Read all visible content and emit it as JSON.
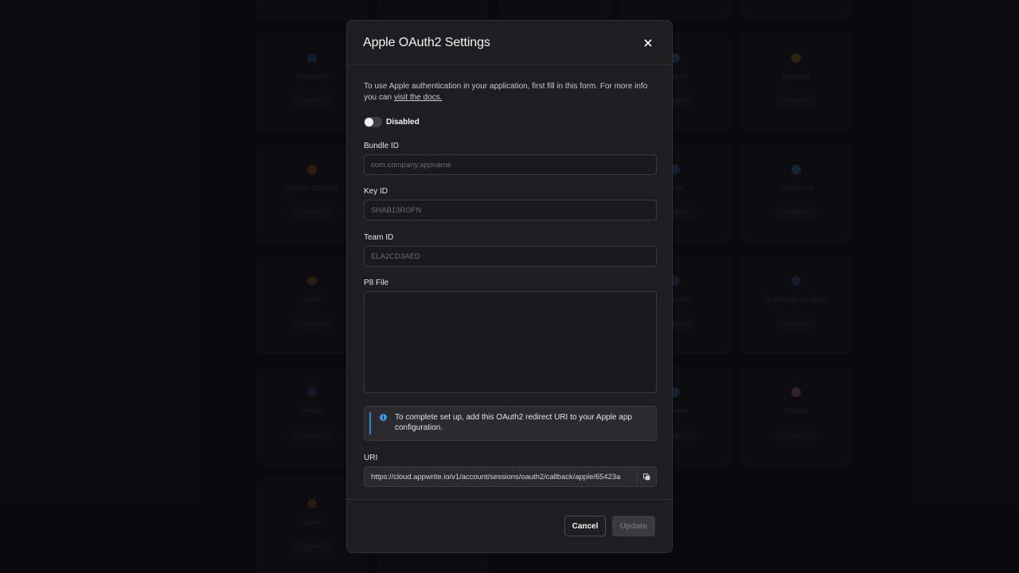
{
  "background_cards": [
    {
      "name": "",
      "badge": "Disabled",
      "icon_color": "#3a3a44"
    },
    {
      "name": "",
      "badge": "Disabled",
      "icon_color": "#3a3a44"
    },
    {
      "name": "",
      "badge": "Disabled",
      "icon_color": "#3a3a44"
    },
    {
      "name": "",
      "badge": "Disabled",
      "icon_color": "#3a3a44"
    },
    {
      "name": "",
      "badge": "Disabled",
      "icon_color": "#3a3a44"
    },
    {
      "name": "Facebook",
      "badge": "Disabled",
      "icon_color": "#2d5aa8"
    },
    {
      "name": "",
      "badge": "",
      "icon_color": "#3a3a44"
    },
    {
      "name": "",
      "badge": "",
      "icon_color": "#3a3a44"
    },
    {
      "name": "Linkedin",
      "badge": "Disabled",
      "icon_color": "#2b6ea8"
    },
    {
      "name": "Microsoft",
      "badge": "Disabled",
      "icon_color": "#9a7a2a"
    },
    {
      "name": "OpenID Connect",
      "badge": "Disabled",
      "icon_color": "#a8561e"
    },
    {
      "name": "",
      "badge": "",
      "icon_color": "#3a3a44"
    },
    {
      "name": "",
      "badge": "",
      "icon_color": "#3a3a44"
    },
    {
      "name": "Podio",
      "badge": "Disabled",
      "icon_color": "#2b6ea8"
    },
    {
      "name": "Salesforce",
      "badge": "Disabled",
      "icon_color": "#2b7fb8"
    },
    {
      "name": "Slack",
      "badge": "Disabled",
      "icon_color": "#8a5a2a"
    },
    {
      "name": "",
      "badge": "",
      "icon_color": "#3a3a44"
    },
    {
      "name": "",
      "badge": "",
      "icon_color": "#3a3a44"
    },
    {
      "name": "Tradeshift",
      "badge": "Disabled",
      "icon_color": "#2b5a88"
    },
    {
      "name": "Tradeshift Sandbox",
      "badge": "Disabled",
      "icon_color": "#2b5a88"
    },
    {
      "name": "Twitch",
      "badge": "Disabled",
      "icon_color": "#4a3a7a"
    },
    {
      "name": "",
      "badge": "",
      "icon_color": "#3a3a44"
    },
    {
      "name": "",
      "badge": "",
      "icon_color": "#3a3a44"
    },
    {
      "name": "Yammer",
      "badge": "Disabled",
      "icon_color": "#2b6ea8"
    },
    {
      "name": "Yandex",
      "badge": "Disabled",
      "icon_color": "#a86a8a"
    },
    {
      "name": "Zoho",
      "badge": "Disabled",
      "icon_color": "#7a5a2a"
    },
    {
      "name": "",
      "badge": "Disabled",
      "icon_color": "#3a3a44"
    }
  ],
  "modal": {
    "title": "Apple OAuth2 Settings",
    "description": "To use Apple authentication in your application, first fill in this form. For more info you can ",
    "docs_link": "visit the docs.",
    "toggle": {
      "label": "Disabled",
      "enabled": false
    },
    "bundle_id": {
      "label": "Bundle ID",
      "placeholder": "com.company.appname",
      "value": ""
    },
    "key_id": {
      "label": "Key ID",
      "placeholder": "SHAB13ROFN",
      "value": ""
    },
    "team_id": {
      "label": "Team ID",
      "placeholder": "ELA2CD3AED",
      "value": ""
    },
    "p8_file": {
      "label": "P8 File",
      "value": ""
    },
    "alert": {
      "text": "To complete set up, add this OAuth2 redirect URI to your Apple app configuration.",
      "icon": "info-icon"
    },
    "uri": {
      "label": "URI",
      "value": "https://cloud.appwrite.io/v1/account/sessions/oauth2/callback/apple/65423a"
    },
    "cancel_label": "Cancel",
    "update_label": "Update"
  },
  "colors": {
    "accent_info": "#2b88c4",
    "modal_bg": "#1e1e21",
    "page_bg": "#0f0f11"
  }
}
